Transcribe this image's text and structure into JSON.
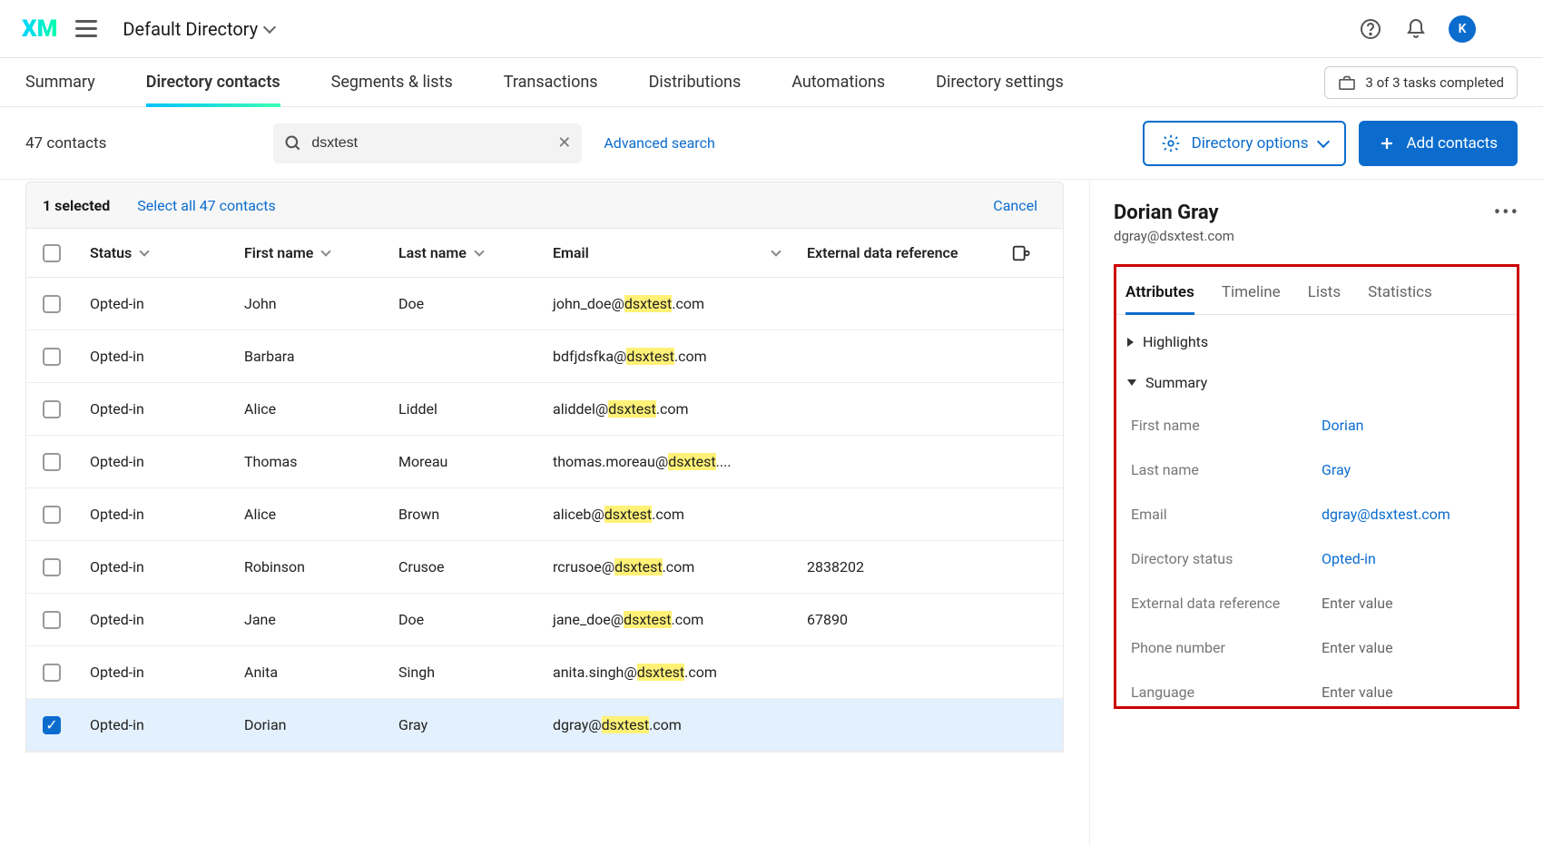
{
  "header": {
    "logo": "XM",
    "directory_label": "Default Directory",
    "avatar_initial": "K"
  },
  "tabs": {
    "items": [
      "Summary",
      "Directory contacts",
      "Segments & lists",
      "Transactions",
      "Distributions",
      "Automations",
      "Directory settings"
    ],
    "active": 1,
    "task_badge": "3 of 3 tasks completed"
  },
  "toolbar": {
    "count": "47 contacts",
    "search_value": "dsxtest",
    "search_placeholder": "Search",
    "advanced": "Advanced search",
    "options_label": "Directory options",
    "add_label": "Add contacts"
  },
  "selection": {
    "summary": "1 selected",
    "select_all": "Select all 47 contacts",
    "cancel": "Cancel"
  },
  "columns": {
    "status": "Status",
    "first_name": "First name",
    "last_name": "Last name",
    "email": "Email",
    "external": "External data reference"
  },
  "highlight": "dsxtest",
  "rows": [
    {
      "status": "Opted-in",
      "first": "John",
      "last": "Doe",
      "email_pre": "john_doe@",
      "email_post": ".com",
      "ext": "",
      "checked": false
    },
    {
      "status": "Opted-in",
      "first": "Barbara",
      "last": "",
      "email_pre": "bdfjdsfka@",
      "email_post": ".com",
      "ext": "",
      "checked": false
    },
    {
      "status": "Opted-in",
      "first": "Alice",
      "last": "Liddel",
      "email_pre": "aliddel@",
      "email_post": ".com",
      "ext": "",
      "checked": false
    },
    {
      "status": "Opted-in",
      "first": "Thomas",
      "last": "Moreau",
      "email_pre": "thomas.moreau@",
      "email_post": "....",
      "ext": "",
      "checked": false
    },
    {
      "status": "Opted-in",
      "first": "Alice",
      "last": "Brown",
      "email_pre": "aliceb@",
      "email_post": ".com",
      "ext": "",
      "checked": false
    },
    {
      "status": "Opted-in",
      "first": "Robinson",
      "last": "Crusoe",
      "email_pre": "rcrusoe@",
      "email_post": ".com",
      "ext": "2838202",
      "checked": false
    },
    {
      "status": "Opted-in",
      "first": "Jane",
      "last": "Doe",
      "email_pre": "jane_doe@",
      "email_post": ".com",
      "ext": "67890",
      "checked": false
    },
    {
      "status": "Opted-in",
      "first": "Anita",
      "last": "Singh",
      "email_pre": "anita.singh@",
      "email_post": ".com",
      "ext": "",
      "checked": false
    },
    {
      "status": "Opted-in",
      "first": "Dorian",
      "last": "Gray",
      "email_pre": "dgray@",
      "email_post": ".com",
      "ext": "",
      "checked": true
    }
  ],
  "detail": {
    "name": "Dorian Gray",
    "email": "dgray@dsxtest.com",
    "tabs": [
      "Attributes",
      "Timeline",
      "Lists",
      "Statistics"
    ],
    "sec_highlights": "Highlights",
    "sec_summary": "Summary",
    "fields": {
      "first_name_k": "First name",
      "first_name_v": "Dorian",
      "last_name_k": "Last name",
      "last_name_v": "Gray",
      "email_k": "Email",
      "email_v": "dgray@dsxtest.com",
      "status_k": "Directory status",
      "status_v": "Opted-in",
      "ext_k": "External data reference",
      "ext_v": "Enter value",
      "phone_k": "Phone number",
      "phone_v": "Enter value",
      "lang_k": "Language",
      "lang_v": "Enter value"
    }
  }
}
